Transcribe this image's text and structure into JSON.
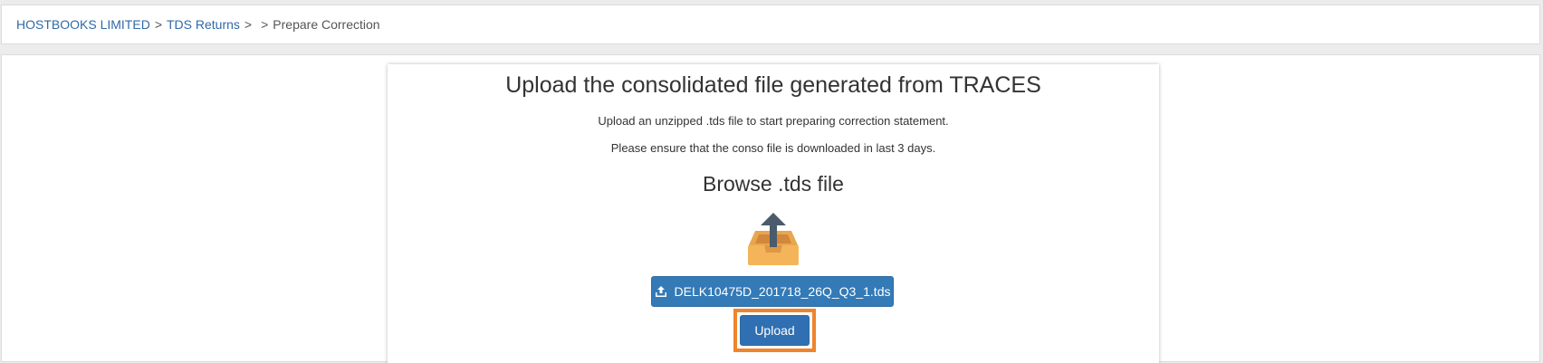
{
  "breadcrumb": {
    "company": "HOSTBOOKS LIMITED",
    "separator": ">",
    "section": "TDS Returns",
    "current": "Prepare Correction"
  },
  "main": {
    "title": "Upload the consolidated file generated from TRACES",
    "subtitle_1": "Upload an unzipped .tds file to start preparing correction statement.",
    "subtitle_2": "Please ensure that the conso file is downloaded in last 3 days.",
    "browse_title": "Browse .tds file",
    "file_button_label": "DELK10475D_201718_26Q_Q3_1.tds",
    "upload_button_label": "Upload"
  },
  "icons": {
    "upload_tray": "upload-tray-icon",
    "file_upload": "upload-arrow-icon"
  },
  "colors": {
    "link": "#2f6aa7",
    "primary_button": "#337ab7",
    "highlight": "#f0842c",
    "tray": "#f4b55a",
    "arrow": "#4a5c6b"
  }
}
